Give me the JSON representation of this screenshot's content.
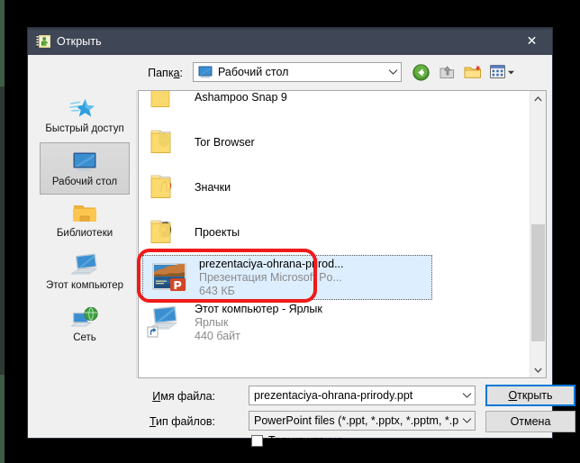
{
  "window": {
    "title": "Открыть",
    "title_icon": "presentation-icon",
    "close_label": "✕"
  },
  "toolbar": {
    "look_in_label": "Папка:",
    "look_in_label_accel": "а",
    "current_folder": "Рабочий стол",
    "current_folder_icon": "desktop-icon",
    "buttons": [
      {
        "name": "back-button",
        "icon": "back-arrow-icon"
      },
      {
        "name": "up-one-level-button",
        "icon": "up-folder-icon"
      },
      {
        "name": "new-folder-button",
        "icon": "new-folder-icon"
      },
      {
        "name": "views-button",
        "icon": "views-grid-icon"
      }
    ]
  },
  "sidebar": {
    "items": [
      {
        "label": "Быстрый доступ",
        "icon": "star-icon",
        "selected": false
      },
      {
        "label": "Рабочий стол",
        "icon": "desktop-icon",
        "selected": true
      },
      {
        "label": "Библиотеки",
        "icon": "library-folder-icon",
        "selected": false
      },
      {
        "label": "Этот компьютер",
        "icon": "this-pc-icon",
        "selected": false
      },
      {
        "label": "Сеть",
        "icon": "network-globe-icon",
        "selected": false
      }
    ]
  },
  "filelist": {
    "items": [
      {
        "name": "Ashampoo Snap 9",
        "type": "",
        "size": "",
        "icon": "folder-icon",
        "selected": false,
        "clipped_top": true
      },
      {
        "name": "Tor Browser",
        "type": "",
        "size": "",
        "icon": "folder-globe-icon",
        "selected": false
      },
      {
        "name": "Значки",
        "type": "",
        "size": "",
        "icon": "folder-icons-icon",
        "selected": false
      },
      {
        "name": "Проекты",
        "type": "",
        "size": "",
        "icon": "folder-media-icon",
        "selected": false
      },
      {
        "name": "prezentaciya-ohrana-prirod...",
        "type": "Презентация Microsoft Po...",
        "size": "643 КБ",
        "icon": "powerpoint-thumbnail-icon",
        "selected": true
      },
      {
        "name": "Этот компьютер - Ярлык",
        "type": "Ярлык",
        "size": "440 байт",
        "icon": "this-pc-shortcut-icon",
        "selected": false
      }
    ],
    "scrollbar": {
      "up_arrow": "⌃",
      "down_arrow": "⌄"
    }
  },
  "form": {
    "file_name_label": "Имя файла:",
    "file_name_accel": "И",
    "file_name_value": "prezentaciya-ohrana-prirody.ppt",
    "file_type_label": "Тип файлов:",
    "file_type_accel": "Т",
    "file_type_value": "PowerPoint files (*.ppt, *.pptx, *.pptm, *.ppsx, *.p",
    "open_button": "Открыть",
    "open_button_accel": "О",
    "cancel_button": "Отмена",
    "readonly_label": "Только чтение",
    "readonly_accel": "ч",
    "readonly_checked": false
  },
  "annotation": {
    "type": "red-rounded-rectangle",
    "color": "#ef1a1a",
    "target": "selected file row"
  },
  "colors": {
    "titlebar": "#3f4757",
    "dialog_bg": "#f0f0f0",
    "list_bg": "#ffffff",
    "selection_bg": "#ddeeff",
    "focus_blue": "#0078d7",
    "annotation_red": "#ef1a1a",
    "page_bg": "#000000"
  }
}
